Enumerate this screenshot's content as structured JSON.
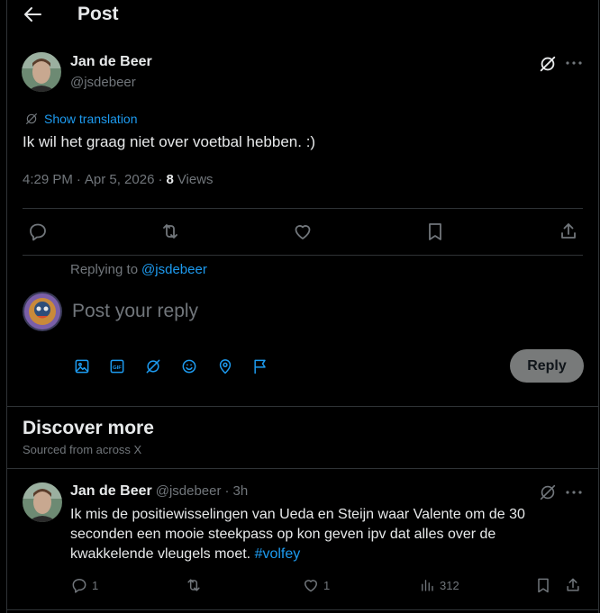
{
  "header": {
    "title": "Post"
  },
  "post": {
    "author_name": "Jan de Beer",
    "author_handle": "@jsdebeer",
    "translate_label": "Show translation",
    "text": "Ik wil het graag niet over voetbal hebben. :)",
    "time": "4:29 PM",
    "sep": "·",
    "date": "Apr 5, 2026",
    "views_count": "8",
    "views_label": "Views"
  },
  "reply": {
    "replying_to_prefix": "Replying to",
    "replying_to_handle": "@jsdebeer",
    "placeholder": "Post your reply",
    "button_label": "Reply"
  },
  "discover": {
    "title": "Discover more",
    "subtitle": "Sourced from across X"
  },
  "related_post": {
    "author_name": "Jan de Beer",
    "author_handle": "@jsdebeer",
    "sep": "·",
    "time_ago": "3h",
    "text": "Ik mis de positiewisselingen van Ueda en Steijn waar Valente om de 30 seconden een mooie steekpass op kon geven ipv dat alles over de kwakkelende vleugels moet.",
    "hashtag": "#volfey",
    "replies": "1",
    "likes": "1",
    "views": "312"
  },
  "colors": {
    "accent": "#1d9bf0",
    "muted": "#71767b",
    "text": "#e7e9ea",
    "border": "#2f3336",
    "button_bg": "#787a7a"
  }
}
